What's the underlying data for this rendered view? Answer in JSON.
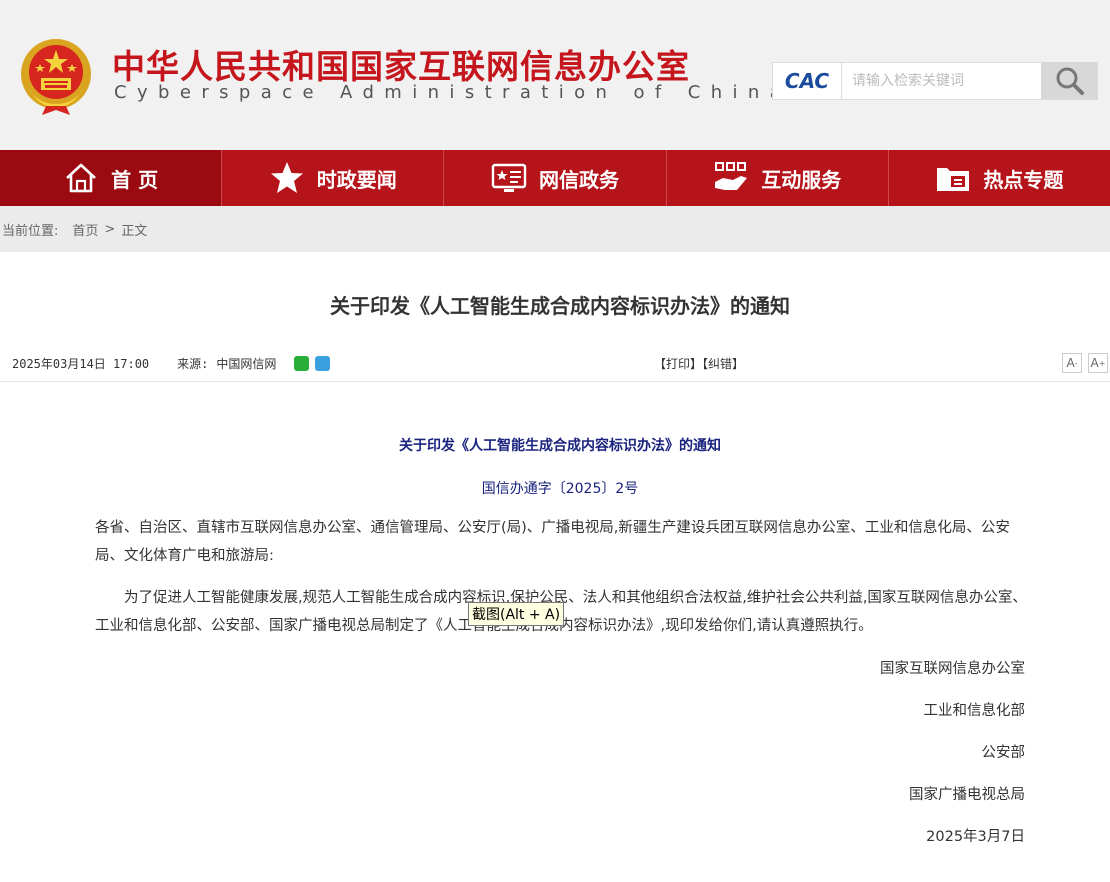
{
  "header": {
    "title_cn": "中华人民共和国国家互联网信息办公室",
    "title_en": "Cyberspace Administration of China",
    "search_logo": "CAC",
    "search_placeholder": "请输入检索关键词",
    "brand_color": "#c4161c"
  },
  "nav": {
    "items": [
      {
        "label": "首 页",
        "icon": "home-icon",
        "active": true
      },
      {
        "label": "时政要闻",
        "icon": "star-icon"
      },
      {
        "label": "网信政务",
        "icon": "monitor-icon"
      },
      {
        "label": "互动服务",
        "icon": "service-icon"
      },
      {
        "label": "热点专题",
        "icon": "folder-icon"
      }
    ],
    "bg_color": "#b5141a"
  },
  "breadcrumb": {
    "label": "当前位置:",
    "home": "首页",
    "sep": ">",
    "current": "正文"
  },
  "article": {
    "title": "关于印发《人工智能生成合成内容标识办法》的通知",
    "date": "2025年03月14日 17:00",
    "source_label": "来源:",
    "source": "中国网信网",
    "print": "【打印】",
    "correct": "【纠错】",
    "font_small": "A",
    "font_large": "A",
    "doc_title": "关于印发《人工智能生成合成内容标识办法》的通知",
    "doc_no": "国信办通字〔2025〕2号",
    "para1": "各省、自治区、直辖市互联网信息办公室、通信管理局、公安厅(局)、广播电视局,新疆生产建设兵团互联网信息办公室、工业和信息化局、公安局、文化体育广电和旅游局:",
    "para2": "为了促进人工智能健康发展,规范人工智能生成合成内容标识,保护公民、法人和其他组织合法权益,维护社会公共利益,国家互联网信息办公室、工业和信息化部、公安部、国家广播电视总局制定了《人工智能生成合成内容标识办法》,现印发给你们,请认真遵照执行。",
    "signatures": [
      "国家互联网信息办公室",
      "工业和信息化部",
      "公安部",
      "国家广播电视总局",
      "2025年3月7日"
    ]
  },
  "tooltip": "截图(Alt + A)"
}
